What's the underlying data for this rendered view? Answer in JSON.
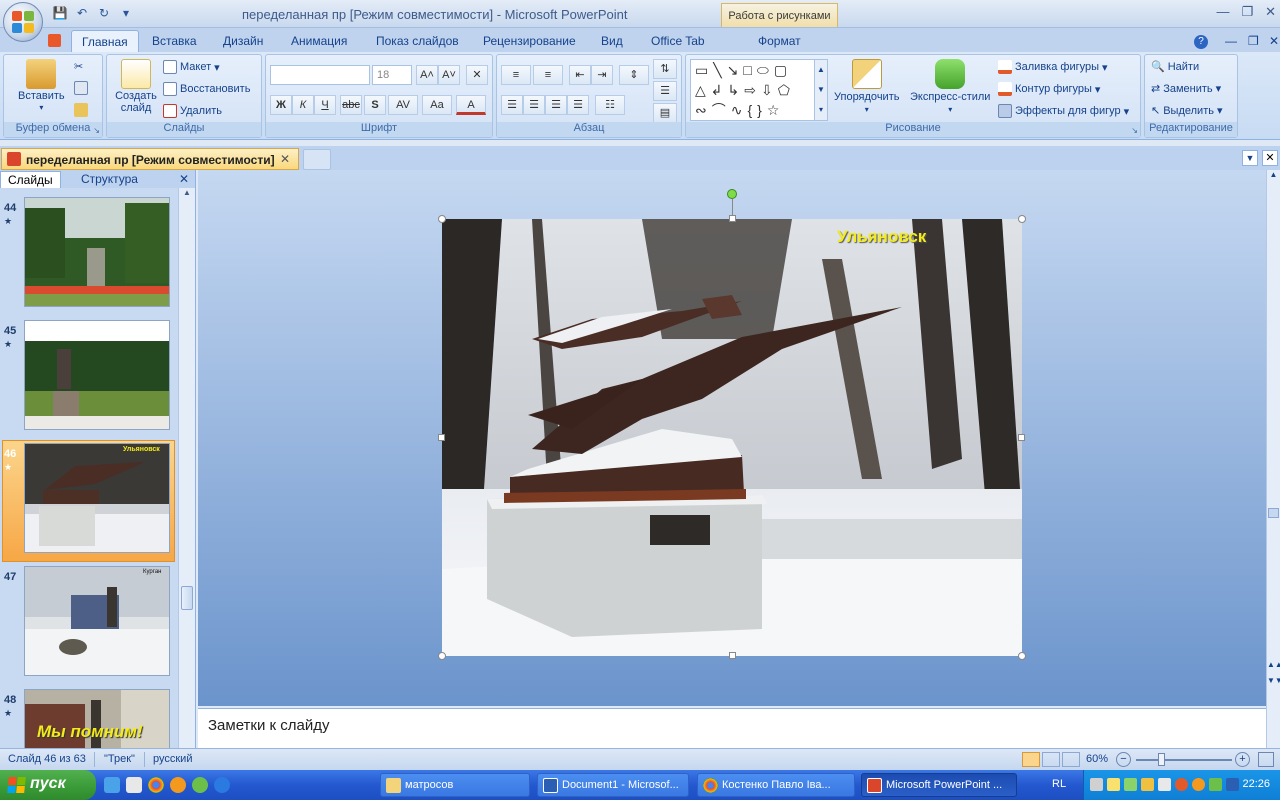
{
  "titlebar": {
    "title": "переделанная пр [Режим совместимости] - Microsoft PowerPoint",
    "context_tab_title": "Работа с рисунками"
  },
  "ribbon_tabs": [
    "Главная",
    "Вставка",
    "Дизайн",
    "Анимация",
    "Показ слайдов",
    "Рецензирование",
    "Вид",
    "Office Tab",
    "Формат"
  ],
  "groups": {
    "clipboard": {
      "label": "Буфер обмена",
      "paste": "Вставить"
    },
    "slides": {
      "label": "Слайды",
      "new_slide": "Создать слайд",
      "layout": "Макет",
      "reset": "Восстановить",
      "delete": "Удалить"
    },
    "font": {
      "label": "Шрифт",
      "font_name": "",
      "font_size": "18"
    },
    "paragraph": {
      "label": "Абзац"
    },
    "drawing": {
      "label": "Рисование",
      "arrange": "Упорядочить",
      "quick_styles": "Экспресс-стили",
      "shape_fill": "Заливка фигуры",
      "shape_outline": "Контур фигуры",
      "shape_effects": "Эффекты для фигур"
    },
    "editing": {
      "label": "Редактирование",
      "find": "Найти",
      "replace": "Заменить",
      "select": "Выделить"
    }
  },
  "doc_tab": {
    "label": "переделанная пр [Режим совместимости]"
  },
  "left_pane": {
    "tabs": [
      "Слайды",
      "Структура"
    ],
    "thumbnails": [
      {
        "num": "44",
        "caption": ""
      },
      {
        "num": "45",
        "caption": ""
      },
      {
        "num": "46",
        "caption": "Ульяновск",
        "selected": true
      },
      {
        "num": "47",
        "caption": "Курган"
      },
      {
        "num": "48",
        "caption": "Мы помним!"
      }
    ]
  },
  "slide": {
    "city_label": "Ульяновск"
  },
  "notes": {
    "placeholder": "Заметки к слайду"
  },
  "statusbar": {
    "slide_info": "Слайд 46 из 63",
    "theme": "\"Трек\"",
    "language": "русский",
    "zoom": "60%"
  },
  "taskbar": {
    "start": "пуск",
    "tasks": [
      {
        "label": "матросов"
      },
      {
        "label": "Document1 - Microsof..."
      },
      {
        "label": "Костенко Павло Іва..."
      },
      {
        "label": "Microsoft PowerPoint ...",
        "active": true
      }
    ],
    "lang": "RL",
    "clock": "22:26"
  }
}
